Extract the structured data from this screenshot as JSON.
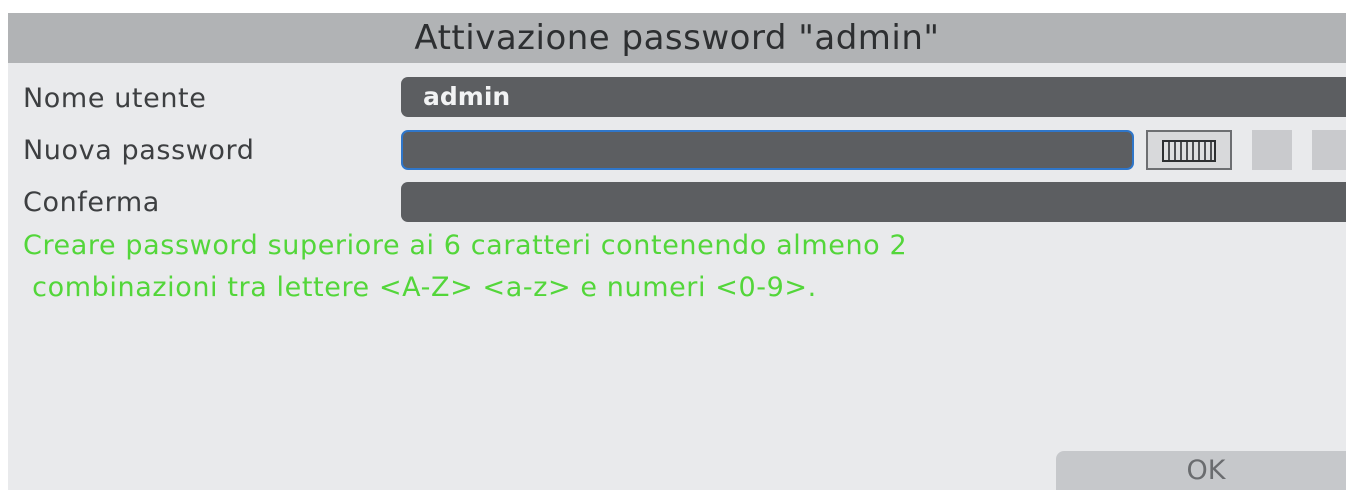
{
  "dialog": {
    "title": "Attivazione password \"admin\"",
    "fields": [
      {
        "label": "Nome utente",
        "value": "admin"
      },
      {
        "label": "Nuova password",
        "value": ""
      },
      {
        "label": "Conferma",
        "value": ""
      }
    ],
    "hint_line1": "Creare password superiore ai 6 caratteri contenendo almeno 2",
    "hint_line2": " combinazioni tra lettere <A-Z> <a-z> e numeri <0-9>.",
    "ok_label": "OK",
    "keyboard_icon": "keyboard-icon"
  },
  "colors": {
    "hint": "#53d63a",
    "focus_border": "#2f76c9",
    "field_bg": "#5c5e61"
  }
}
